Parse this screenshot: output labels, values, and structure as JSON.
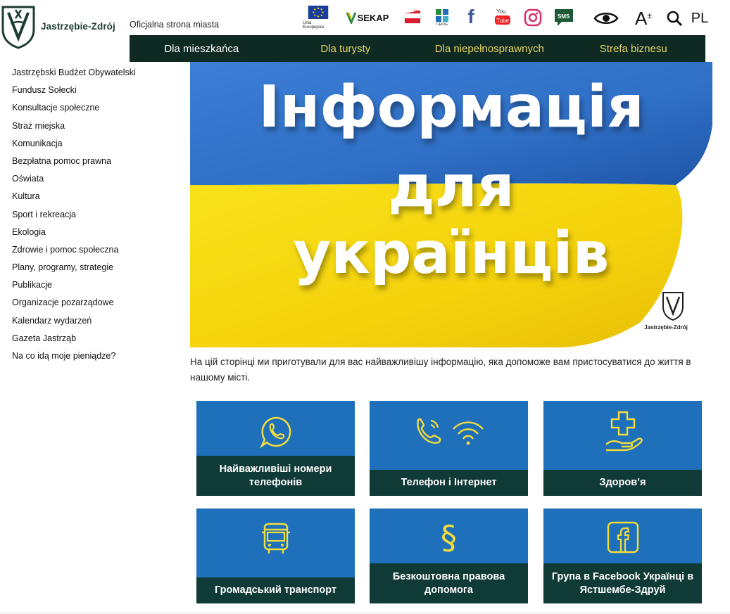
{
  "header": {
    "site_name": "Jastrzębie-Zdrój",
    "tagline": "Oficjalna strona miasta",
    "partners": [
      {
        "name": "eu-flag-icon",
        "label": "Unia Europejska"
      },
      {
        "name": "sekap-icon",
        "label": "SEKAP"
      },
      {
        "name": "bip-icon",
        "label": "bip"
      },
      {
        "name": "ceidg-icon",
        "label": "CEIDG"
      },
      {
        "name": "facebook-icon",
        "label": "f"
      },
      {
        "name": "youtube-icon",
        "label": "You Tube"
      },
      {
        "name": "instagram-icon",
        "label": ""
      },
      {
        "name": "sms-icon",
        "label": "SMS"
      }
    ],
    "tools": {
      "contrast": "eye-icon",
      "font_size": "A",
      "font_size_sup": "±",
      "search": "search-icon",
      "language": "PL"
    }
  },
  "nav": {
    "items": [
      {
        "label": "Dla mieszkańca",
        "active": true
      },
      {
        "label": "Dla turysty",
        "active": false
      },
      {
        "label": "Dla niepełnosprawnych",
        "active": false
      },
      {
        "label": "Strefa biznesu",
        "active": false
      }
    ]
  },
  "sidebar": {
    "items": [
      "Jastrzębski Budżet Obywatelski",
      "Fundusz Sołecki",
      "Konsultacje społeczne",
      "Straż miejska",
      "Komunikacja",
      "Bezpłatna pomoc prawna",
      "Oświata",
      "Kultura",
      "Sport i rekreacja",
      "Ekologia",
      "Zdrowie i pomoc społeczna",
      "Plany, programy, strategie",
      "Publikacje",
      "Organizacje pozarządowe",
      "Kalendarz wydarzeń",
      "Gazeta Jastrząb",
      "Na co idą moje pieniądze?"
    ]
  },
  "banner": {
    "line1": "Інформація",
    "line2": "для",
    "line3": "українців",
    "logo_caption": "Jastrzębie-Zdrój"
  },
  "intro": "На цій сторінці ми приготували для вас найважливішу інформацію, яка допоможе вам пристосуватися до життя в нашому місті.",
  "tiles": [
    {
      "icon": "whatsapp-icon",
      "label": "Найважливіші номери телефонів"
    },
    {
      "icon": "phone-wifi-icon",
      "label": "Телефон і Інтернет"
    },
    {
      "icon": "health-icon",
      "label": "Здоров’я"
    },
    {
      "icon": "bus-icon",
      "label": "Громадський транспорт"
    },
    {
      "icon": "paragraph-icon",
      "label": "Безкоштовна правова допомога"
    },
    {
      "icon": "facebook-icon",
      "label": "Група в Facebook Українці в Ястшембе-Здруй"
    }
  ],
  "colors": {
    "nav_bg": "#0f2a23",
    "nav_text": "#e7d565",
    "tile_bg": "#1e70bb",
    "tile_label_bg": "#0f3a35",
    "icon_yellow": "#f4dc3a",
    "flag_blue": "#2f6fc6",
    "flag_yellow": "#f7dc12"
  }
}
